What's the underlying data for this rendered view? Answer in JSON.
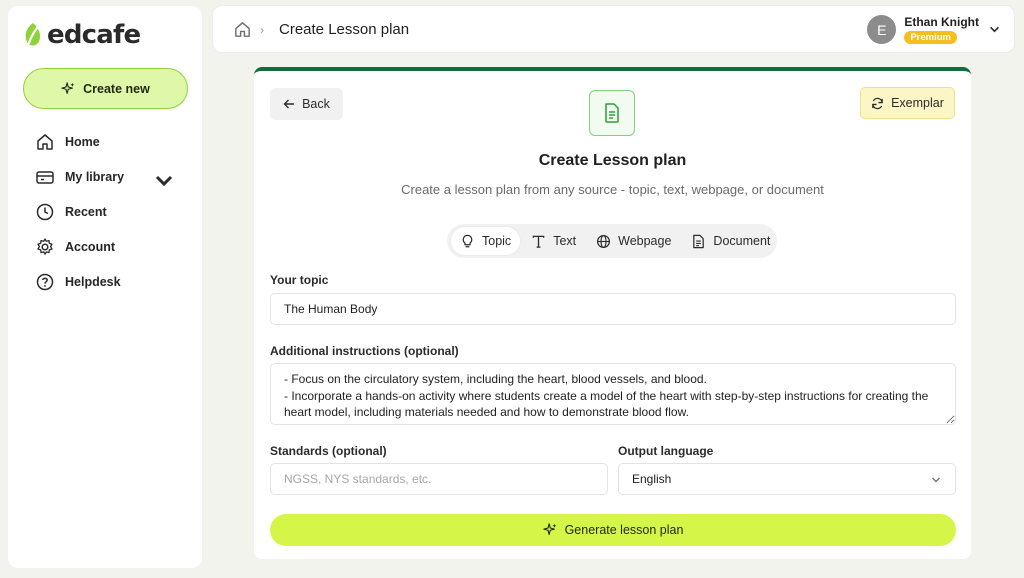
{
  "brand": {
    "name": "edcafe",
    "accent": "#8fd33a",
    "dark_green": "#146c3c",
    "lime": "#d6f549"
  },
  "sidebar": {
    "create_label": "Create new",
    "items": [
      {
        "label": "Home",
        "icon": "home-icon"
      },
      {
        "label": "My library",
        "icon": "library-icon",
        "has_submenu": true
      },
      {
        "label": "Recent",
        "icon": "clock-icon"
      },
      {
        "label": "Account",
        "icon": "gear-icon"
      },
      {
        "label": "Helpdesk",
        "icon": "help-icon"
      }
    ]
  },
  "header": {
    "title": "Create Lesson plan",
    "user": {
      "initial": "E",
      "name": "Ethan Knight",
      "badge": "Premium"
    }
  },
  "card": {
    "back_label": "Back",
    "exemplar_label": "Exemplar",
    "title": "Create Lesson plan",
    "subtitle": "Create a lesson plan from any source - topic, text, webpage, or document",
    "tabs": [
      {
        "label": "Topic",
        "icon": "lightbulb-icon",
        "active": true
      },
      {
        "label": "Text",
        "icon": "text-icon",
        "active": false
      },
      {
        "label": "Webpage",
        "icon": "globe-icon",
        "active": false
      },
      {
        "label": "Document",
        "icon": "document-icon",
        "active": false
      }
    ]
  },
  "form": {
    "topic_label": "Your topic",
    "topic_value": "The Human Body",
    "instructions_label": "Additional instructions (optional)",
    "instructions_value": "- Focus on the circulatory system, including the heart, blood vessels, and blood.\n- Incorporate a hands-on activity where students create a model of the heart with step-by-step instructions for creating the heart model, including materials needed and how to demonstrate blood flow.",
    "standards_label": "Standards (optional)",
    "standards_placeholder": "NGSS, NYS standards, etc.",
    "standards_value": "",
    "language_label": "Output language",
    "language_value": "English",
    "generate_label": "Generate lesson plan"
  }
}
